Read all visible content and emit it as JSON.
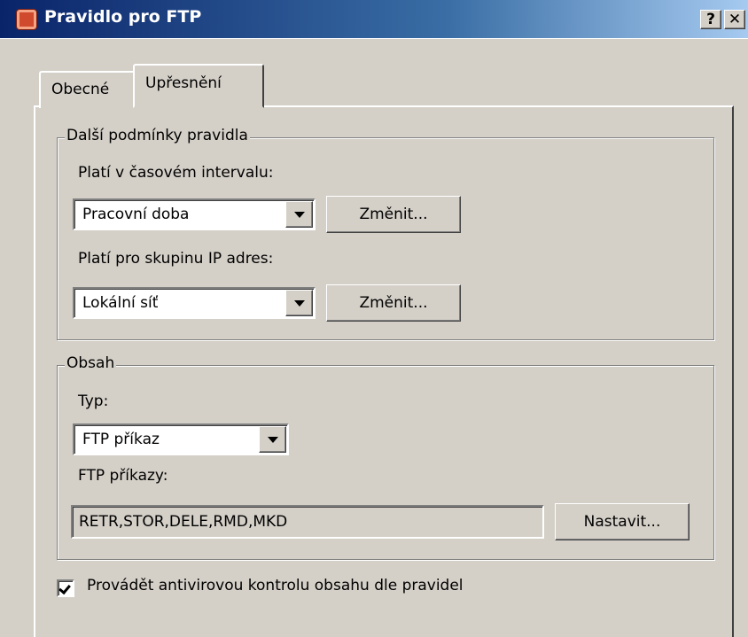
{
  "window": {
    "title": "Pravidlo pro FTP",
    "help_button": "?",
    "close_button": "✕"
  },
  "tabs": [
    {
      "label": "Obecné",
      "active": false
    },
    {
      "label": "Upřesnění",
      "active": true
    }
  ],
  "conditions_group": {
    "legend": "Další podmínky pravidla",
    "time_label": "Platí v časovém intervalu:",
    "time_value": "Pracovní doba",
    "time_change_button": "Změnit...",
    "ip_label": "Platí pro skupinu IP adres:",
    "ip_value": "Lokální síť",
    "ip_change_button": "Změnit..."
  },
  "content_group": {
    "legend": "Obsah",
    "type_label": "Typ:",
    "type_value": "FTP příkaz",
    "commands_label": "FTP příkazy:",
    "commands_value": "RETR,STOR,DELE,RMD,MKD",
    "set_button": "Nastavit..."
  },
  "antivirus": {
    "label": "Provádět antivirovou kontrolu obsahu dle pravidel",
    "checked": true
  }
}
